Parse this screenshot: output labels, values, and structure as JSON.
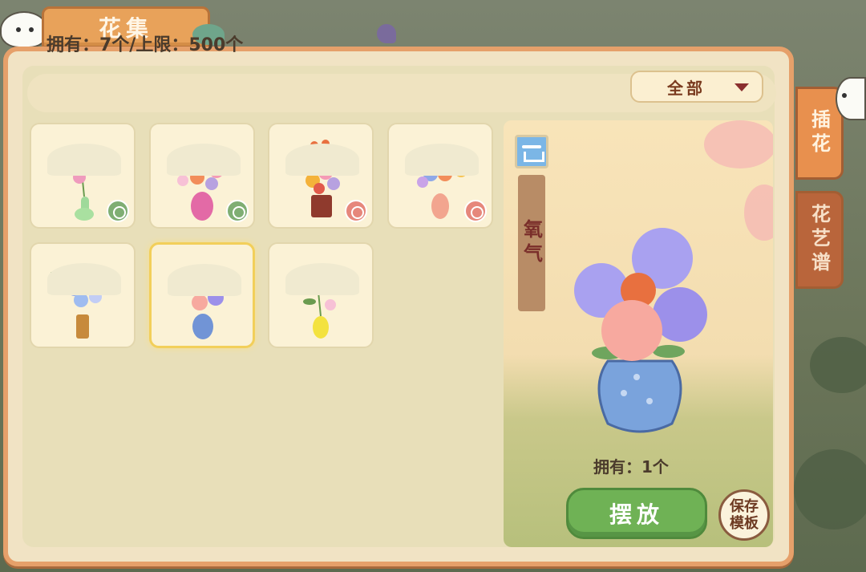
{
  "header": {
    "title": "花集"
  },
  "toolbar": {
    "count_text": "拥有：7个/上限：500个",
    "filter_value": "全部"
  },
  "side_tabs": [
    {
      "label": "插花",
      "active": true
    },
    {
      "label": "花艺谱",
      "active": false
    }
  ],
  "grid": {
    "items": [
      {
        "name": "pink-lilac-green-vase",
        "badge": "green"
      },
      {
        "name": "mixed-bouquet-pink-vase",
        "badge": "green"
      },
      {
        "name": "sunflower-lantern-bouquet",
        "badge": "red"
      },
      {
        "name": "rainbow-bouquet-vase",
        "badge": "red"
      },
      {
        "name": "hydrangea-leaf-tall-vase",
        "badge": ""
      },
      {
        "name": "hydrangea-blue-vase",
        "badge": "",
        "selected": true
      },
      {
        "name": "peony-yellow-vase",
        "badge": ""
      }
    ]
  },
  "preview": {
    "stat_label": "氧气",
    "owned_text": "拥有：1个",
    "place_button": "摆放",
    "save_line1": "保存",
    "save_line2": "模板"
  },
  "colors": {
    "panel_border": "#e6a06a",
    "accent_green": "#6fb255",
    "title_tab": "#e8a25a"
  }
}
